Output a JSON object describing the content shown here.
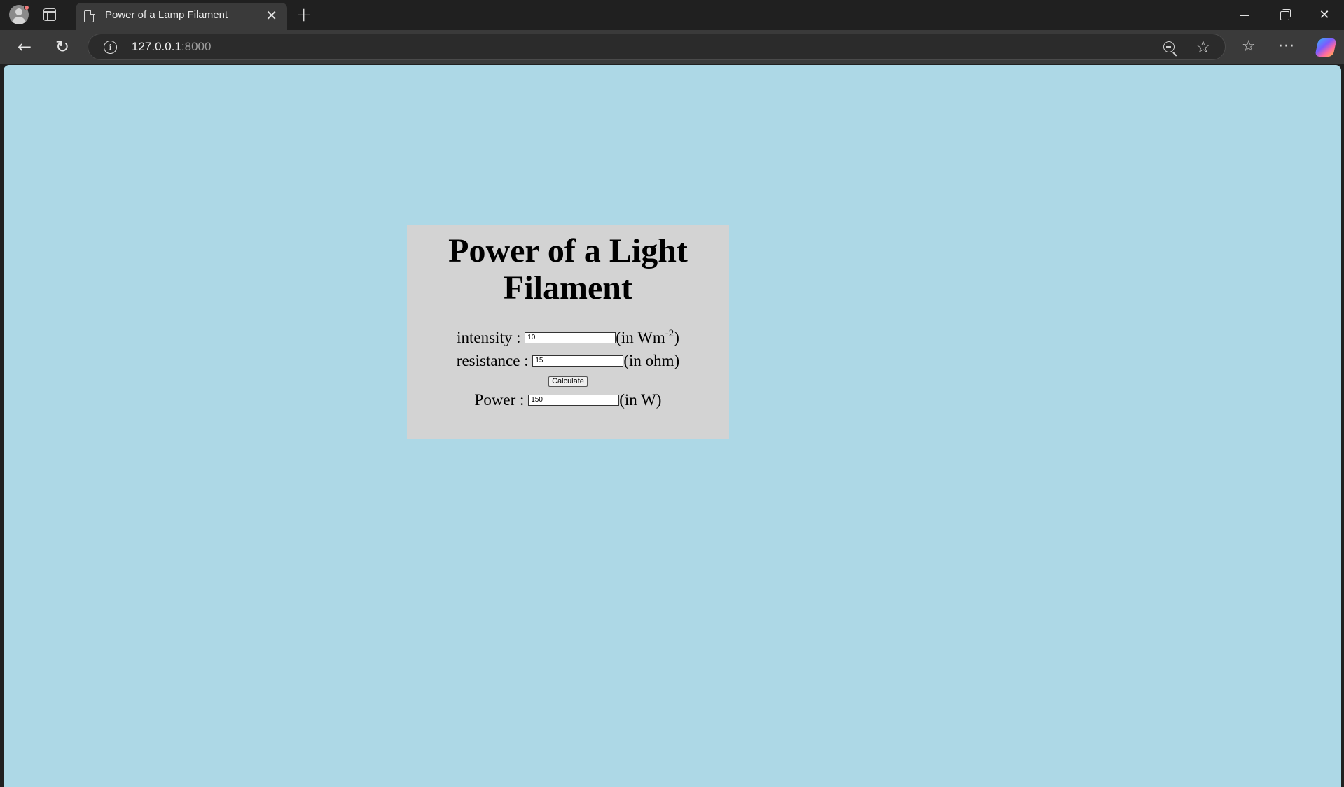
{
  "browser": {
    "tab_title": "Power of a Lamp Filament",
    "url_host": "127.0.0.1",
    "url_port": ":8000"
  },
  "page": {
    "background_color": "#add8e6",
    "card_color": "#d3d3d3",
    "heading": "Power of a Light Filament",
    "intensity_label": "intensity : ",
    "intensity_value": "10",
    "intensity_unit_prefix": "(in Wm",
    "intensity_unit_exp": "-2",
    "intensity_unit_suffix": ")",
    "resistance_label": "resistance : ",
    "resistance_value": "15",
    "resistance_unit": "(in ohm)",
    "calculate_label": "Calculate",
    "power_label": "Power : ",
    "power_value": "150",
    "power_unit": "(in W)"
  }
}
